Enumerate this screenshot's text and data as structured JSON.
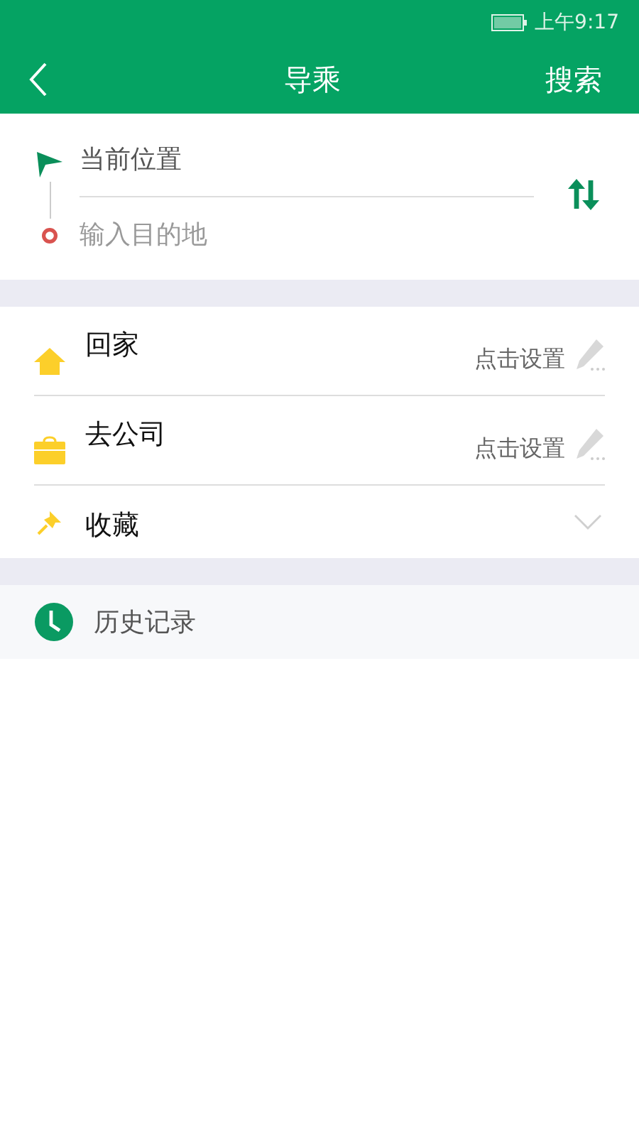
{
  "status_bar": {
    "time": "上午9:17"
  },
  "header": {
    "title": "导乘",
    "action": "搜索"
  },
  "route": {
    "origin": {
      "value": "当前位置"
    },
    "destination": {
      "placeholder": "输入目的地"
    }
  },
  "shortcuts": [
    {
      "kind": "home",
      "label": "回家",
      "hint": "点击设置"
    },
    {
      "kind": "work",
      "label": "去公司",
      "hint": "点击设置"
    },
    {
      "kind": "favorites",
      "label": "收藏",
      "expanded": false
    }
  ],
  "history": {
    "label": "历史记录"
  }
}
